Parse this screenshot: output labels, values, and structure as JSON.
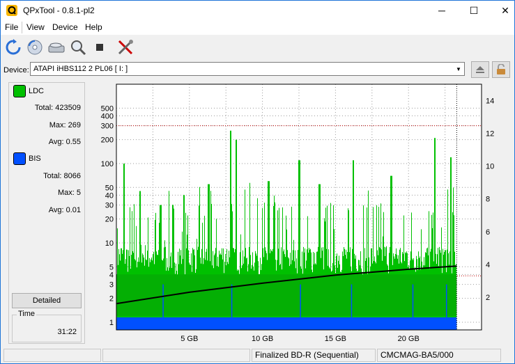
{
  "window": {
    "title": "QPxTool - 0.8.1-pl2",
    "minimize": "─",
    "maximize": "☐",
    "close": "✕"
  },
  "menu": {
    "file": "File",
    "view": "View",
    "device": "Device",
    "help": "Help"
  },
  "toolbar": [
    "refresh-icon",
    "disc-scan-icon",
    "drive-icon",
    "zoom-icon",
    "stop-icon",
    "tools-icon"
  ],
  "device": {
    "label": "Device:",
    "selected": "ATAPI   iHBS112   2    PL06 [ I: ]"
  },
  "legend": {
    "ldc": {
      "label": "LDC",
      "color": "#00c000",
      "total_label": "Total:",
      "total": "423509",
      "max_label": "Max:",
      "max": "269",
      "avg_label": "Avg:",
      "avg": "0.55"
    },
    "bis": {
      "label": "BIS",
      "color": "#0050ff",
      "total_label": "Total:",
      "total": "8066",
      "max_label": "Max:",
      "max": "5",
      "avg_label": "Avg:",
      "avg": "0.01"
    }
  },
  "detailed_button": "Detailed",
  "time": {
    "label": "Time",
    "value": "31:22"
  },
  "status": {
    "disc_type": "Finalized BD-R (Sequential)",
    "media_id": "CMCMAG-BA5/000"
  },
  "chart_data": {
    "type": "bar",
    "x_label_ticks": [
      "5 GB",
      "10 GB",
      "15 GB",
      "20 GB"
    ],
    "x_ticks_gb": [
      5,
      10,
      15,
      20
    ],
    "xlim": [
      0,
      25
    ],
    "data_end_gb": 23.3,
    "y_left_scale": "log",
    "y_left_ticks": [
      1,
      2,
      3,
      4,
      5,
      10,
      20,
      30,
      40,
      50,
      100,
      200,
      300,
      400,
      500
    ],
    "y_left_lim": [
      0.8,
      1000
    ],
    "y_right_ticks": [
      2,
      4,
      6,
      8,
      10,
      12,
      14
    ],
    "y_right_lim": [
      0,
      15
    ],
    "threshold_left": 300,
    "threshold_right": 3.3,
    "ldc_peaks": [
      [
        0.5,
        100
      ],
      [
        1.6,
        45
      ],
      [
        3.0,
        30
      ],
      [
        4.6,
        40
      ],
      [
        6.3,
        55
      ],
      [
        7.8,
        260
      ],
      [
        8.2,
        200
      ],
      [
        10.4,
        60
      ],
      [
        12.5,
        110
      ],
      [
        13.9,
        55
      ],
      [
        16.2,
        110
      ],
      [
        18.8,
        70
      ],
      [
        21.8,
        210
      ],
      [
        22.9,
        120
      ]
    ],
    "ldc_base": 4,
    "bis_level": 1,
    "speed_curve": [
      [
        0,
        1.6
      ],
      [
        5,
        2.3
      ],
      [
        10,
        2.85
      ],
      [
        15,
        3.35
      ],
      [
        20,
        3.7
      ],
      [
        23.3,
        3.9
      ]
    ],
    "series": [
      {
        "name": "LDC",
        "color": "#00c000"
      },
      {
        "name": "BIS",
        "color": "#0050ff"
      }
    ],
    "grid": true
  }
}
